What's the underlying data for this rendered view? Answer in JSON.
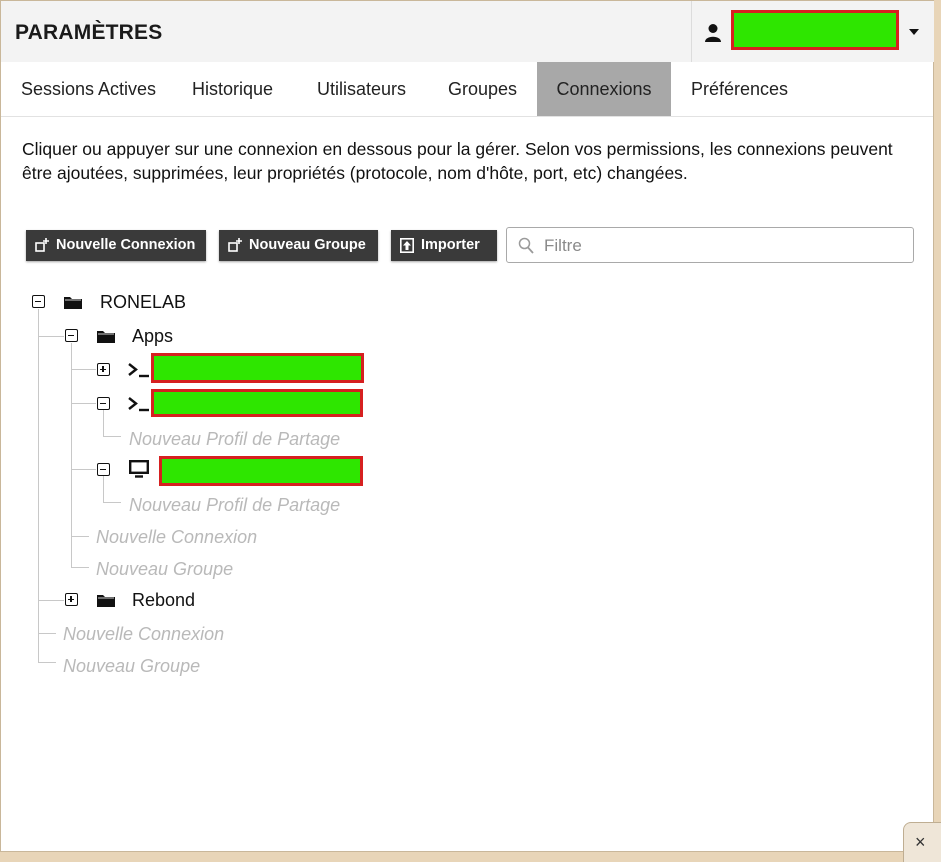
{
  "header": {
    "title": "PARAMÈTRES",
    "user_name": ""
  },
  "tabs": [
    {
      "label": "Sessions Actives",
      "active": false
    },
    {
      "label": "Historique",
      "active": false
    },
    {
      "label": "Utilisateurs",
      "active": false
    },
    {
      "label": "Groupes",
      "active": false
    },
    {
      "label": "Connexions",
      "active": true
    },
    {
      "label": "Préférences",
      "active": false
    }
  ],
  "help_text": "Cliquer ou appuyer sur une connexion en dessous pour la gérer. Selon vos permissions, les connexions peuvent être ajoutées, supprimées, leur propriétés (protocole, nom d'hôte, port, etc) changées.",
  "toolbar": {
    "new_connection": "Nouvelle Connexion",
    "new_group": "Nouveau Groupe",
    "import": "Importer",
    "filter_placeholder": "Filtre"
  },
  "tree": {
    "root": "RONELAB",
    "apps": "Apps",
    "connection_1": "",
    "connection_2": "",
    "connection_3": "",
    "new_sharing_profile": "Nouveau Profil de Partage",
    "new_connection": "Nouvelle Connexion",
    "new_group": "Nouveau Groupe",
    "rebond": "Rebond"
  },
  "colors": {
    "active_tab": "#a8a8a8",
    "button": "#3a3a3a",
    "redaction_fill": "#2ee600",
    "redaction_border": "#d62020"
  },
  "close_label": "×"
}
